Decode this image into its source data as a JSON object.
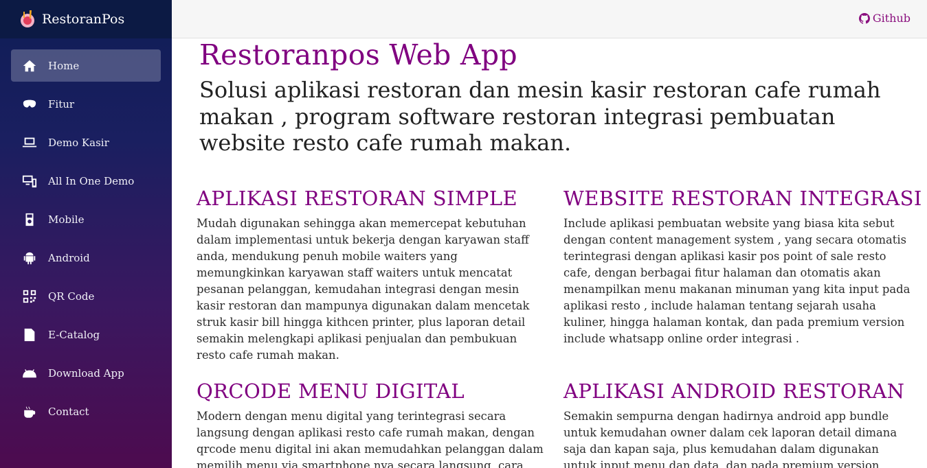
{
  "brand": {
    "name": "RestoranPos"
  },
  "sidebar": {
    "items": [
      {
        "label": "Home",
        "icon": "home-icon",
        "active": true
      },
      {
        "label": "Fitur",
        "icon": "mask-icon"
      },
      {
        "label": "Demo Kasir",
        "icon": "laptop-icon"
      },
      {
        "label": "All In One Demo",
        "icon": "desktop-mobile-icon"
      },
      {
        "label": "Mobile",
        "icon": "mobile-icon"
      },
      {
        "label": "Android",
        "icon": "android-icon"
      },
      {
        "label": "QR Code",
        "icon": "qrcode-icon"
      },
      {
        "label": "E-Catalog",
        "icon": "file-pdf-icon"
      },
      {
        "label": "Download App",
        "icon": "android-head-icon"
      },
      {
        "label": "Contact",
        "icon": "coffee-icon"
      }
    ]
  },
  "topbar": {
    "github_label": "Github"
  },
  "hero": {
    "title": "Restoranpos Web App",
    "subtitle": "Solusi aplikasi restoran dan mesin kasir restoran cafe rumah makan , program software restoran integrasi pembuatan website resto cafe rumah makan."
  },
  "features": [
    {
      "title": "APLIKASI RESTORAN SIMPLE",
      "text": "Mudah digunakan sehingga akan memercepat kebutuhan dalam implementasi untuk bekerja dengan karyawan staff anda, mendukung penuh mobile waiters yang memungkinkan karyawan staff waiters untuk mencatat pesanan pelanggan, kemudahan integrasi dengan mesin kasir restoran dan mampunya digunakan dalam mencetak struk kasir bill hingga kithcen printer, plus laporan detail semakin melengkapi aplikasi penjualan dan pembukuan resto cafe rumah makan."
    },
    {
      "title": "WEBSITE RESTORAN INTEGRASI",
      "text": "Include aplikasi pembuatan website yang biasa kita sebut dengan content management system , yang secara otomatis terintegrasi dengan aplikasi kasir pos point of sale resto cafe, dengan berbagai fitur halaman dan otomatis akan menampilkan menu makanan minuman yang kita input pada aplikasi resto , include halaman tentang sejarah usaha kuliner, hingga halaman kontak, dan pada premium version include whatsapp online order integrasi ."
    },
    {
      "title": "QRCODE MENU DIGITAL",
      "text": "Modern dengan menu digital yang terintegrasi secara langsung dengan aplikasi resto cafe rumah makan, dengan qrcode menu digital ini akan memudahkan pelanggan dalam memilih menu via smartphone nya secara langsung, cara penggunaan nya pun"
    },
    {
      "title": "APLIKASI ANDROID RESTORAN",
      "text": "Semakin sempurna dengan hadirnya android app bundle untuk kemudahan owner dalam cek laporan detail dimana saja dan kapan saja, plus kemudahan dalam digunakan untuk input menu dan data, dan pada premium version sudah termasuk"
    }
  ],
  "colors": {
    "accent": "#800080",
    "sidebar_top": "#0f1d56",
    "sidebar_bottom": "#4d0b4f"
  }
}
